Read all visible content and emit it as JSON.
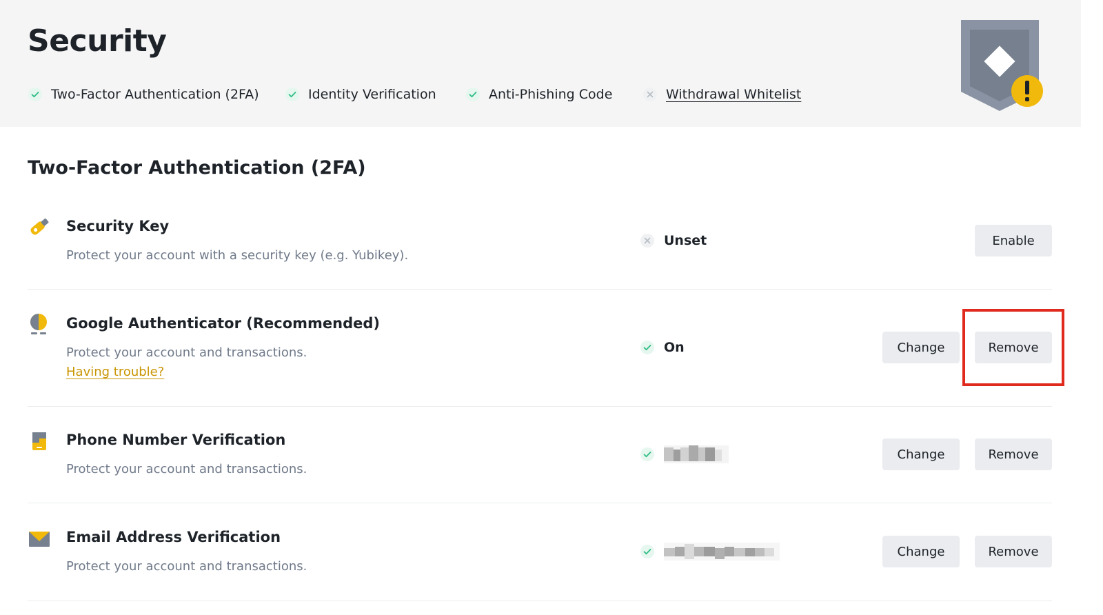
{
  "header": {
    "title": "Security",
    "checklist": [
      {
        "label": "Two-Factor Authentication (2FA)",
        "status": "done",
        "is_link": false
      },
      {
        "label": "Identity Verification",
        "status": "done",
        "is_link": false
      },
      {
        "label": "Anti-Phishing Code",
        "status": "done",
        "is_link": false
      },
      {
        "label": "Withdrawal Whitelist",
        "status": "not-done",
        "is_link": true
      }
    ],
    "badge_icon": "shield-warning-icon"
  },
  "section": {
    "title": "Two-Factor Authentication (2FA)",
    "items": [
      {
        "icon": "security-key-icon",
        "title": "Security Key",
        "description": "Protect your account with a security key (e.g. Yubikey).",
        "status_text": "Unset",
        "status": "unset",
        "buttons": [
          "Enable"
        ]
      },
      {
        "icon": "google-authenticator-icon",
        "title": "Google Authenticator (Recommended)",
        "description": "Protect your account and transactions.",
        "link": "Having trouble?",
        "status_text": "On",
        "status": "on",
        "buttons": [
          "Change",
          "Remove"
        ]
      },
      {
        "icon": "phone-icon",
        "title": "Phone Number Verification",
        "description": "Protect your account and transactions.",
        "status_text": "",
        "status": "on",
        "buttons": [
          "Change",
          "Remove"
        ]
      },
      {
        "icon": "email-icon",
        "title": "Email Address Verification",
        "description": "Protect your account and transactions.",
        "status_text": "",
        "status": "on",
        "buttons": [
          "Change",
          "Remove"
        ]
      }
    ]
  },
  "colors": {
    "accent": "#f0b90b",
    "success": "#2ebd85",
    "highlight": "#e02a1d",
    "link": "#c99400",
    "muted": "#707a8a"
  }
}
